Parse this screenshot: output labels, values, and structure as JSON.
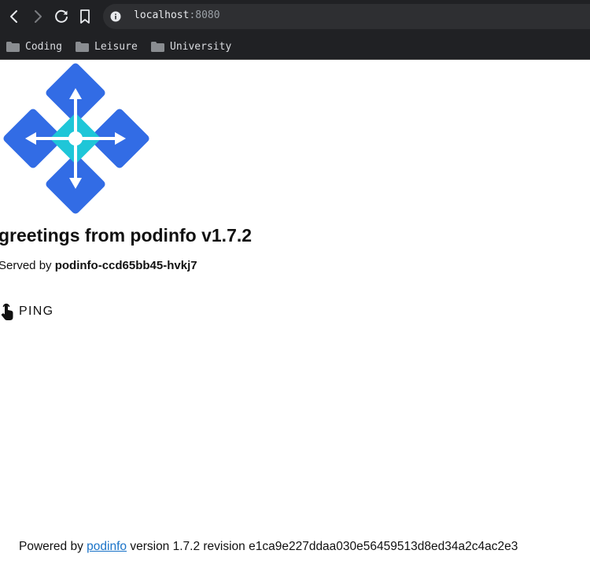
{
  "browser": {
    "url_host": "localhost",
    "url_port": ":8080",
    "bookmarks": [
      {
        "label": "Coding",
        "icon": "folder-icon"
      },
      {
        "label": "Leisure",
        "icon": "folder-icon"
      },
      {
        "label": "University",
        "icon": "folder-icon"
      }
    ]
  },
  "page": {
    "title": "greetings from podinfo v1.7.2",
    "served_prefix": "Served by ",
    "pod_name": "podinfo-ccd65bb45-hvkj7",
    "ping_label": "PING",
    "footer": {
      "prefix": "Powered by ",
      "link_text": "podinfo",
      "suffix": " version 1.7.2 revision e1ca9e227ddaa030e56459513d8ed34a2c4ac2e3"
    }
  },
  "colors": {
    "toolbar_bg": "#202124",
    "logo_blue": "#326ce5",
    "logo_teal": "#1fc6d8",
    "link": "#1a73c8"
  }
}
